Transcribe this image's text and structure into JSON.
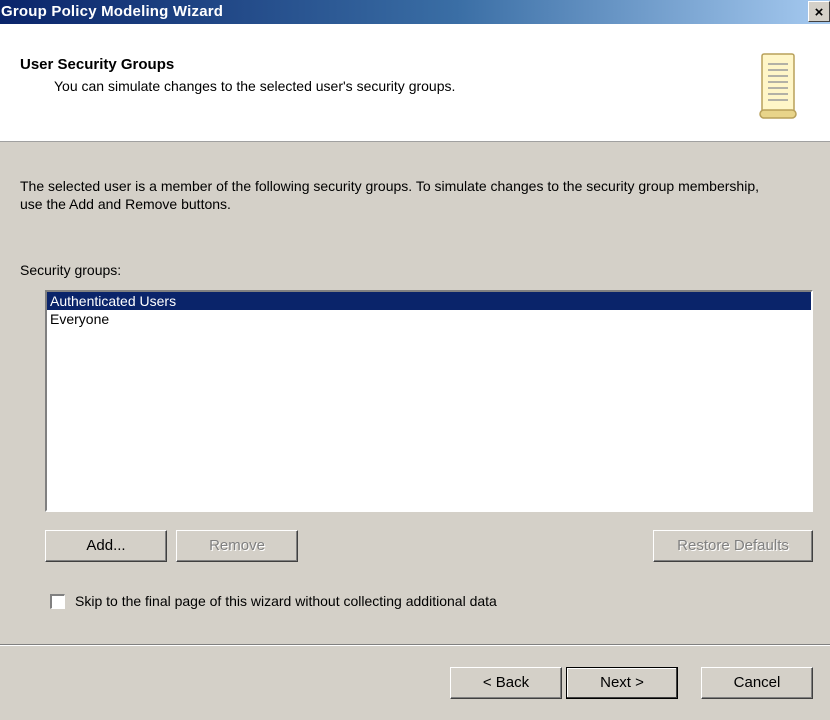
{
  "window": {
    "title": "Group Policy Modeling Wizard",
    "close_glyph": "×"
  },
  "header": {
    "title": "User Security Groups",
    "subtitle": "You can simulate changes to the selected user's security groups.",
    "icon": "scroll-icon"
  },
  "body": {
    "description": "The selected user is a member of the following security groups. To simulate changes to the security group membership, use the Add and Remove buttons.",
    "list_label": "Security groups:",
    "groups": [
      {
        "name": "Authenticated Users",
        "selected": true
      },
      {
        "name": "Everyone",
        "selected": false
      }
    ],
    "buttons": {
      "add": "Add...",
      "remove": "Remove",
      "restore_defaults": "Restore Defaults"
    },
    "skip_checkbox": {
      "label": "Skip to the final page of this wizard without collecting additional data",
      "checked": false
    }
  },
  "footer": {
    "back": "< Back",
    "next": "Next >",
    "cancel": "Cancel"
  },
  "colors": {
    "titlebar_start": "#0a246a",
    "titlebar_end": "#a6caf0",
    "dialog_face": "#d4d0c8",
    "selection": "#0a246a"
  }
}
